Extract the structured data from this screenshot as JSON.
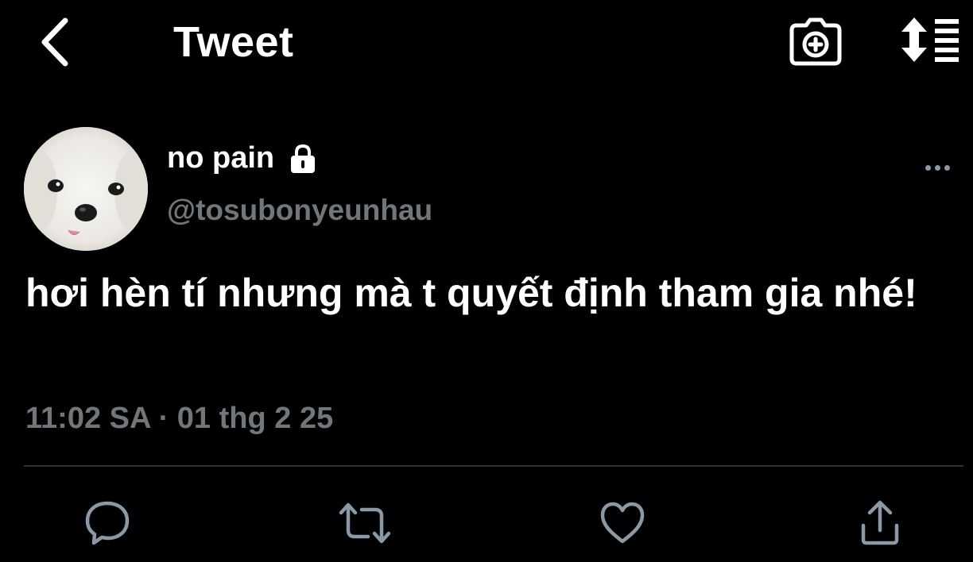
{
  "header": {
    "title": "Tweet",
    "back_icon": "chevron-left-icon",
    "camera_icon": "camera-add-icon",
    "sort_icon": "sort-list-icon"
  },
  "author": {
    "display_name": "no pain",
    "handle": "@tosubonyeunhau",
    "avatar": "white-puppy-avatar",
    "protected_icon": "lock-icon"
  },
  "tweet": {
    "text": "hơi hèn tí nhưng mà t quyết định tham gia nhé!",
    "timestamp": "11:02 SA · 01 thg 2 25"
  },
  "actions": [
    {
      "icon": "reply-icon"
    },
    {
      "icon": "retweet-icon"
    },
    {
      "icon": "like-icon"
    },
    {
      "icon": "share-icon"
    }
  ],
  "colors": {
    "background": "#000000",
    "text": "#ffffff",
    "secondary_text": "#71767b",
    "divider": "#2f3336",
    "icon": "#8b98a5"
  }
}
